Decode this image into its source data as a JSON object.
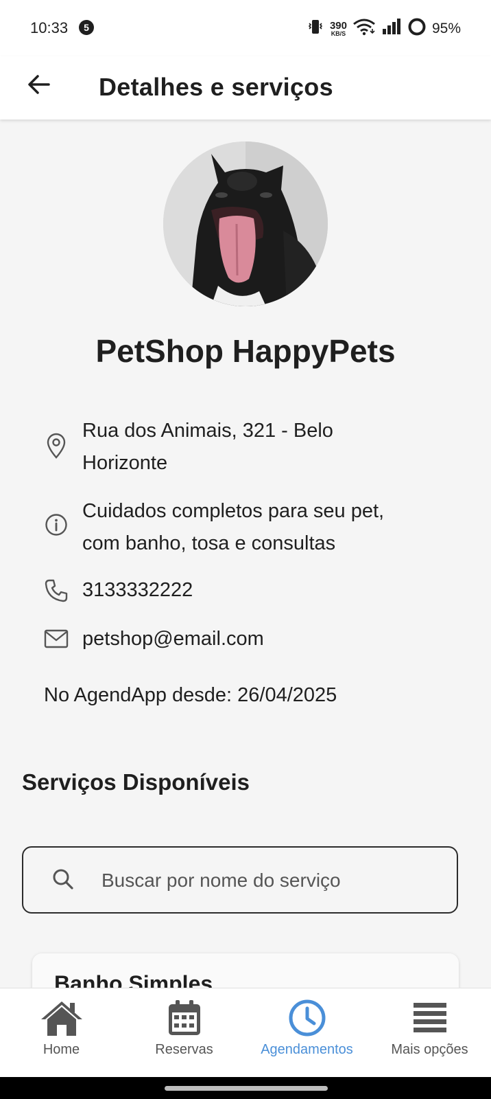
{
  "status_bar": {
    "time": "10:33",
    "notification_count": "5",
    "net_speed_value": "390",
    "net_speed_unit": "KB/S",
    "battery": "95%",
    "icons": [
      "vibrate-icon",
      "wifi-icon",
      "signal-icon",
      "battery-ring-icon"
    ]
  },
  "header": {
    "title": "Detalhes e serviços",
    "back_icon": "arrow-left-icon"
  },
  "shop": {
    "name": "PetShop HappyPets",
    "address_line1": "Rua dos Animais, 321 - Belo",
    "address_line2": "Horizonte",
    "description_line1": "Cuidados completos para seu pet,",
    "description_line2": "com banho, tosa e consultas",
    "phone": "3133332222",
    "email": "petshop@email.com",
    "member_since": "No AgendApp desde: 26/04/2025"
  },
  "services": {
    "title": "Serviços Disponíveis",
    "search_placeholder": "Buscar por nome do serviço",
    "first_card_title": "Banho Simples"
  },
  "bottom_nav": {
    "items": [
      {
        "label": "Home",
        "icon": "home-icon",
        "active": false
      },
      {
        "label": "Reservas",
        "icon": "calendar-icon",
        "active": false
      },
      {
        "label": "Agendamentos",
        "icon": "clock-icon",
        "active": true
      },
      {
        "label": "Mais opções",
        "icon": "menu-icon",
        "active": false
      }
    ]
  },
  "colors": {
    "accent": "#4a8fd8",
    "background": "#f5f5f5",
    "text": "#1f1f1f",
    "icon_gray": "#555555"
  }
}
